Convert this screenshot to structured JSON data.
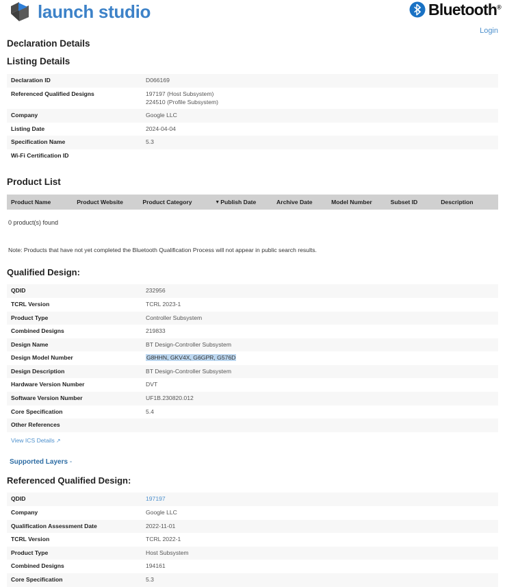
{
  "header": {
    "brand_name": "launch studio",
    "brand_icon": "launch-studio-cube-icon",
    "bluetooth_word": "Bluetooth",
    "bluetooth_trademark": "®",
    "bluetooth_icon": "bluetooth-rune-icon",
    "login_label": "Login"
  },
  "page_title": "Declaration Details",
  "listing_details": {
    "heading": "Listing Details",
    "rows": [
      {
        "label": "Declaration ID",
        "value": "D066169"
      },
      {
        "label": "Referenced Qualified Designs",
        "value": "197197 (Host Subsystem)\n224510 (Profile Subsystem)"
      },
      {
        "label": "Company",
        "value": "Google LLC"
      },
      {
        "label": "Listing Date",
        "value": "2024-04-04"
      },
      {
        "label": "Specification Name",
        "value": "5.3"
      },
      {
        "label": "Wi-Fi Certification ID",
        "value": ""
      }
    ]
  },
  "product_list": {
    "heading": "Product List",
    "columns": [
      "Product Name",
      "Product Website",
      "Product Category",
      "Publish Date",
      "Archive Date",
      "Model Number",
      "Subset ID",
      "Description"
    ],
    "sorted_column": "Publish Date",
    "sort_caret": "▼",
    "result_count_text": "0 product(s) found",
    "note": "Note: Products that have not yet completed the Bluetooth Qualification Process will not appear in public search results."
  },
  "qualified_design": {
    "heading": "Qualified Design:",
    "rows": [
      {
        "label": "QDID",
        "value": "232956"
      },
      {
        "label": "TCRL Version",
        "value": "TCRL 2023-1"
      },
      {
        "label": "Product Type",
        "value": "Controller Subsystem"
      },
      {
        "label": "Combined Designs",
        "value": "219833"
      },
      {
        "label": "Design Name",
        "value": "BT Design-Controller Subsystem"
      },
      {
        "label": "Design Model Number",
        "value": "G8HHN, GKV4X, G6GPR, G576D",
        "highlighted": true
      },
      {
        "label": "Design Description",
        "value": "BT Design-Controller Subsystem"
      },
      {
        "label": "Hardware Version Number",
        "value": "DVT"
      },
      {
        "label": "Software Version Number",
        "value": "UF1B.230820.012"
      },
      {
        "label": "Core Specification",
        "value": "5.4"
      },
      {
        "label": "Other References",
        "value": ""
      }
    ],
    "ics_link_label": "View ICS Details",
    "ics_link_icon": "external-link-icon",
    "supported_layers_label": "Supported Layers",
    "supported_layers_toggle": "-"
  },
  "referenced_qualified_design": {
    "heading": "Referenced Qualified Design:",
    "rows": [
      {
        "label": "QDID",
        "value": "197197",
        "is_link": true
      },
      {
        "label": "Company",
        "value": "Google LLC"
      },
      {
        "label": "Qualification Assessment Date",
        "value": "2022-11-01"
      },
      {
        "label": "TCRL Version",
        "value": "TCRL 2022-1"
      },
      {
        "label": "Product Type",
        "value": "Host Subsystem"
      },
      {
        "label": "Combined Designs",
        "value": "194161"
      },
      {
        "label": "Core Specification",
        "value": "5.3"
      }
    ]
  },
  "colors": {
    "brand_blue": "#3d82c8",
    "link_blue": "#4d90cd",
    "table_header_gray": "#d0d0d0",
    "row_alt_gray": "#f7f7f7",
    "highlight_blue": "#bcd7f0"
  }
}
